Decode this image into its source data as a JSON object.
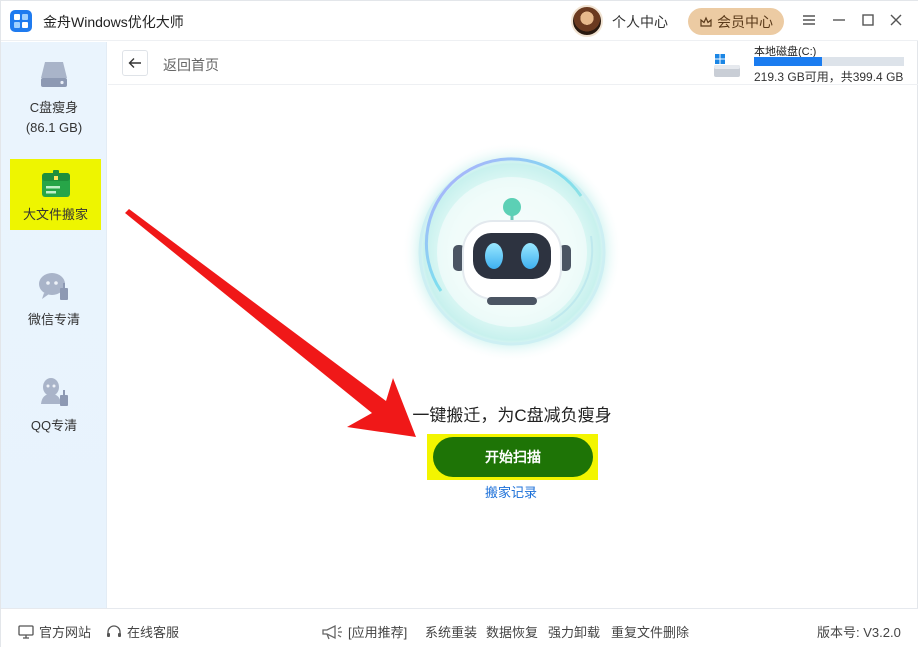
{
  "app": {
    "title": "金舟Windows优化大师"
  },
  "header": {
    "personal_center": "个人中心",
    "vip_center": "会员中心",
    "window_controls": [
      "menu-icon",
      "minimize-icon",
      "maximize-icon",
      "close-icon"
    ]
  },
  "sidebar": {
    "items": [
      {
        "label": "C盘瘦身",
        "sub": "(86.1 GB)",
        "icon": "disk-icon"
      },
      {
        "label": "大文件搬家",
        "icon": "toolbox-icon",
        "active": true
      },
      {
        "label": "微信专清",
        "icon": "wechat-clean-icon"
      },
      {
        "label": "QQ专清",
        "icon": "qq-clean-icon"
      }
    ]
  },
  "content": {
    "back_label": "返回首页",
    "disk": {
      "name": "本地磁盘(C:)",
      "info": "219.3 GB可用，共399.4 GB",
      "used_fraction": 0.45
    },
    "slogan": "一键搬迁，为C盘减负瘦身",
    "start_button": "开始扫描",
    "history_link": "搬家记录"
  },
  "footer": {
    "official_site": "官方网站",
    "online_service": "在线客服",
    "recommend_label": "[应用推荐]",
    "apps": [
      "系统重装",
      "数据恢复",
      "强力卸载",
      "重复文件删除"
    ],
    "version": "版本号: V3.2.0"
  },
  "colors": {
    "accent_blue": "#1a7cf0",
    "button_green": "#1e7406",
    "highlight_yellow": "#f3f500",
    "arrow_red": "#f01818",
    "vip_gold": "#eccba3"
  }
}
